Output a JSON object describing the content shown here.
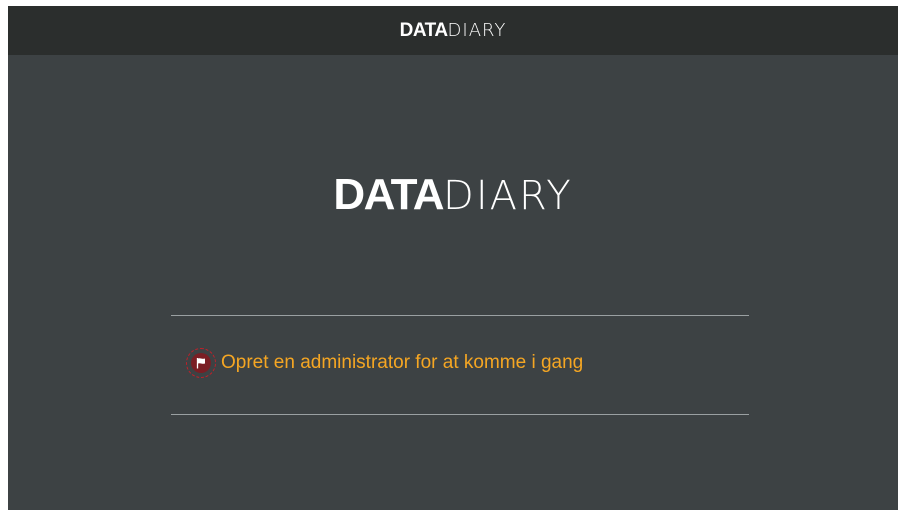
{
  "header": {
    "brand_bold": "DATA",
    "brand_thin": "DIARY"
  },
  "hero": {
    "brand_bold": "DATA",
    "brand_thin": "DIARY"
  },
  "notice": {
    "icon": "flag-icon",
    "text": "Opret en administrator for at komme i gang"
  },
  "colors": {
    "background": "#3d4244",
    "topbar": "#2b2e2d",
    "accent": "#f5a623",
    "rule": "#9aa0a2",
    "badge": "#c0202a"
  }
}
